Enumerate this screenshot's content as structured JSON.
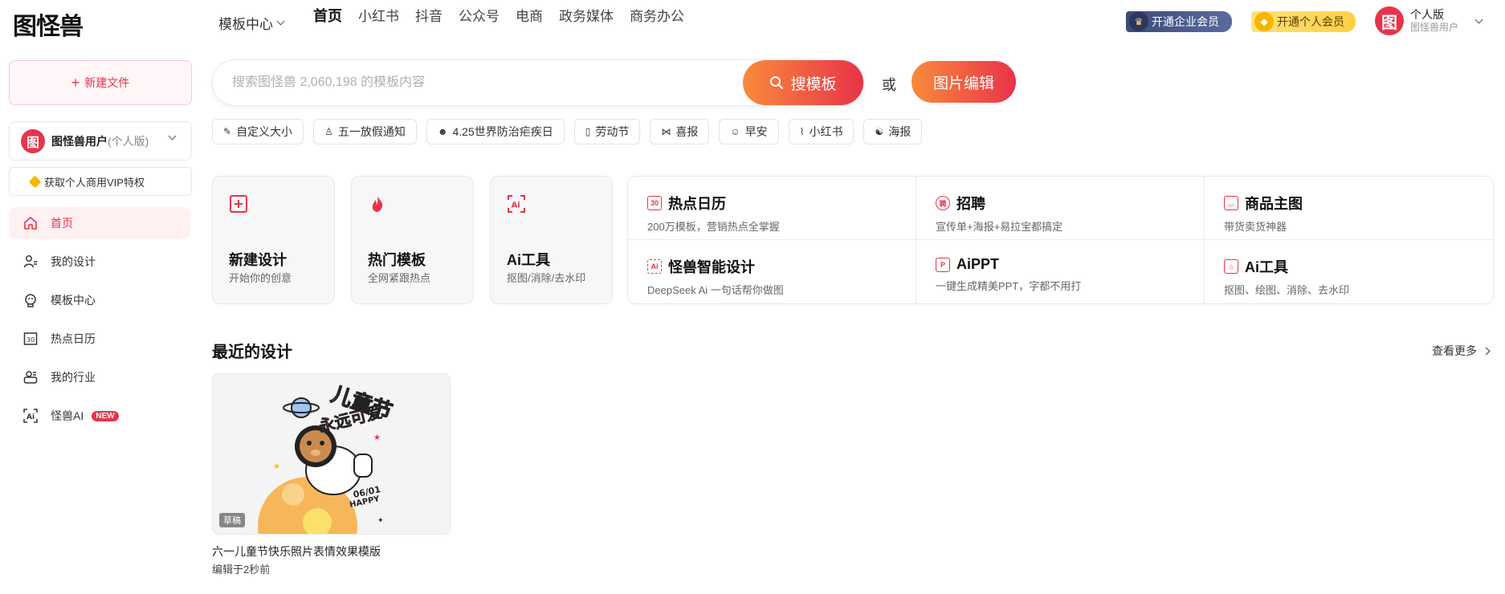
{
  "header": {
    "logo_text": "图怪兽",
    "template_center": "模板中心",
    "nav": [
      "首页",
      "小红书",
      "抖音",
      "公众号",
      "电商",
      "政务媒体",
      "商务办公"
    ],
    "vip_enterprise": "开通企业会员",
    "vip_personal": "开通个人会员",
    "user_plan": "个人版",
    "user_name": "图怪兽用户",
    "avatar_char": "图"
  },
  "sidebar": {
    "new_file": "新建文件",
    "team_name": "图怪兽用户",
    "team_type": "(个人版)",
    "vip_get": "获取个人商用VIP特权",
    "items": [
      {
        "label": "首页",
        "icon": "home-icon"
      },
      {
        "label": "我的设计",
        "icon": "user-design-icon"
      },
      {
        "label": "模板中心",
        "icon": "template-icon"
      },
      {
        "label": "热点日历",
        "icon": "calendar-icon"
      },
      {
        "label": "我的行业",
        "icon": "industry-icon"
      },
      {
        "label": "怪兽AI",
        "icon": "ai-icon",
        "badge": "NEW"
      }
    ]
  },
  "search": {
    "placeholder": "搜索图怪兽 2,060,198 的模板内容",
    "button": "搜模板",
    "or": "或",
    "edit_button": "图片编辑"
  },
  "tags": [
    {
      "label": "自定义大小",
      "icon": "pen-icon"
    },
    {
      "label": "五一放假通知",
      "icon": "person-icon"
    },
    {
      "label": "4.25世界防治疟疾日",
      "icon": "mosquito-icon"
    },
    {
      "label": "劳动节",
      "icon": "phone-icon"
    },
    {
      "label": "喜报",
      "icon": "bow-icon"
    },
    {
      "label": "早安",
      "icon": "smile-icon"
    },
    {
      "label": "小红书",
      "icon": "leaf-icon"
    },
    {
      "label": "海报",
      "icon": "poster-icon"
    }
  ],
  "cards": [
    {
      "title": "新建设计",
      "sub": "开始你的创意",
      "icon": "plus-square-icon"
    },
    {
      "title": "热门模板",
      "sub": "全网紧跟热点",
      "icon": "fire-icon"
    },
    {
      "title": "Ai工具",
      "sub": "抠图/消除/去水印",
      "icon": "ai-scan-icon"
    }
  ],
  "features": [
    {
      "title": "热点日历",
      "sub": "200万模板，营销热点全掌握",
      "icon_char": "30"
    },
    {
      "title": "招聘",
      "sub": "宣传单+海报+易拉宝都搞定",
      "icon_char": "聘"
    },
    {
      "title": "商品主图",
      "sub": "带货卖货神器",
      "icon_char": "◡"
    },
    {
      "title": "怪兽智能设计",
      "sub": "DeepSeek Ai 一句话帮你做图",
      "icon_char": "Ai"
    },
    {
      "title": "AiPPT",
      "sub": "一键生成精美PPT，字都不用打",
      "icon_char": "P"
    },
    {
      "title": "Ai工具",
      "sub": "抠图、绘图、消除、去水印",
      "icon_char": "⌂"
    }
  ],
  "recent": {
    "title": "最近的设计",
    "see_more": "查看更多",
    "item_name": "六一儿童节快乐照片表情效果模版",
    "item_time": "编辑于2秒前",
    "draft": "草稿",
    "poster_title": "儿童节",
    "poster_sub": "永远可爱",
    "poster_date": "06/01",
    "poster_happy": "HAPPY"
  },
  "colors": {
    "brand": "#e8334a",
    "gradient_start": "#f98a3c"
  }
}
